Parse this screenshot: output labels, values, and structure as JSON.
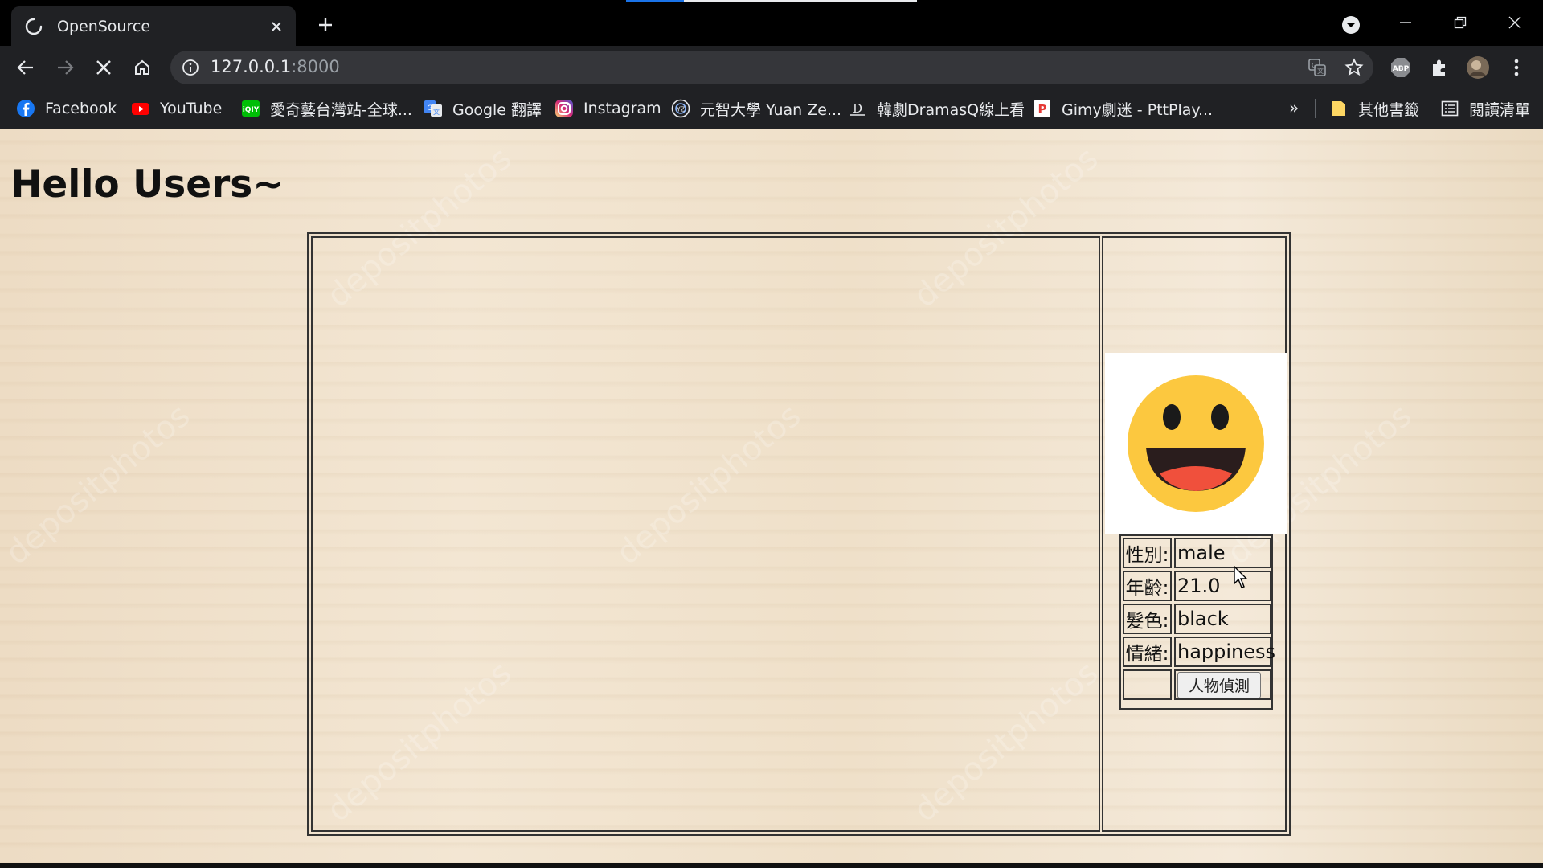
{
  "browser": {
    "tab": {
      "title": "OpenSource"
    },
    "address": {
      "host": "127.0.0.1",
      "port": ":8000"
    },
    "bookmarks": [
      {
        "label": "Facebook",
        "icon": "facebook-icon"
      },
      {
        "label": "YouTube",
        "icon": "youtube-icon"
      },
      {
        "label": "愛奇藝台灣站-全球...",
        "icon": "iqiyi-icon"
      },
      {
        "label": "Google 翻譯",
        "icon": "google-translate-icon"
      },
      {
        "label": "Instagram",
        "icon": "instagram-icon"
      },
      {
        "label": "元智大學 Yuan Ze...",
        "icon": "yzu-icon"
      },
      {
        "label": "韓劇DramasQ線上看",
        "icon": "dramasq-icon"
      },
      {
        "label": "Gimy劇迷 - PttPlay...",
        "icon": "gimy-icon"
      }
    ],
    "bookmarks_overflow": "»",
    "other_bookmarks": "其他書籤",
    "reading_list": "閱讀清單",
    "colors": {
      "chrome_dark": "#202124",
      "accent": "#1a73e8"
    }
  },
  "page": {
    "heading": "Hello Users~",
    "watermark": "depositphotos",
    "emoji": "smiling-face-icon",
    "info": {
      "rows": [
        {
          "key": "性別:",
          "value": "male"
        },
        {
          "key": "年齡:",
          "value": "21.0"
        },
        {
          "key": "髮色:",
          "value": "black"
        },
        {
          "key": "情緒:",
          "value": "happiness"
        }
      ],
      "detect_button": "人物偵測"
    }
  }
}
